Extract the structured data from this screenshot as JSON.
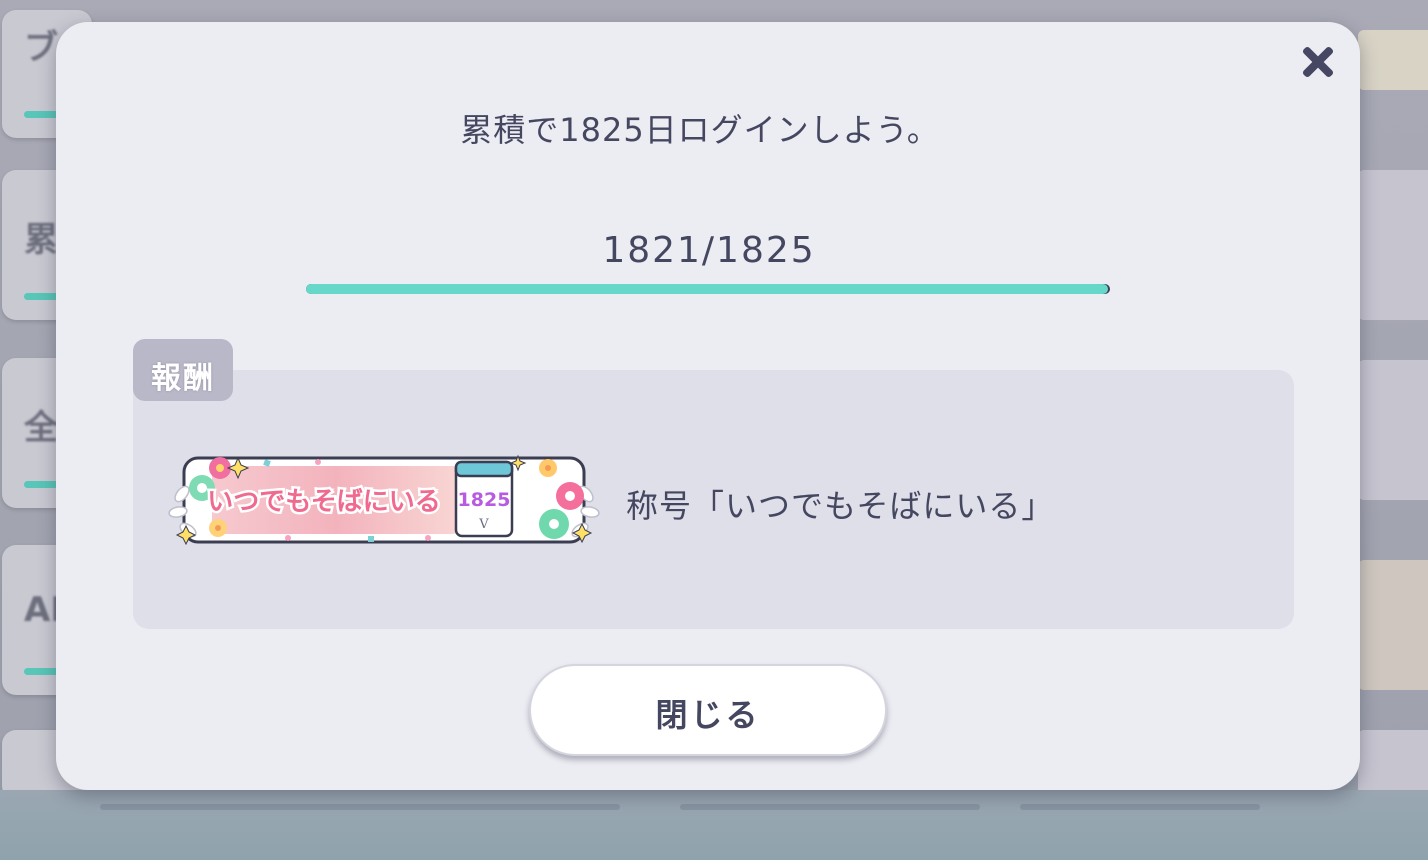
{
  "dialog": {
    "mission_text": "累積で1825日ログインしよう。",
    "progress": {
      "label": "1821/1825",
      "current": 1821,
      "goal": 1825
    },
    "reward": {
      "tag_label": "報酬",
      "badge_text": "いつでもそばにいる",
      "badge_number": "1825",
      "reward_name": "称号「いつでもそばにいる」"
    },
    "close_button_label": "閉じる"
  },
  "colors": {
    "progress_fill": "#66d8c9",
    "panel": "#dfdfe9",
    "text": "#454760"
  }
}
